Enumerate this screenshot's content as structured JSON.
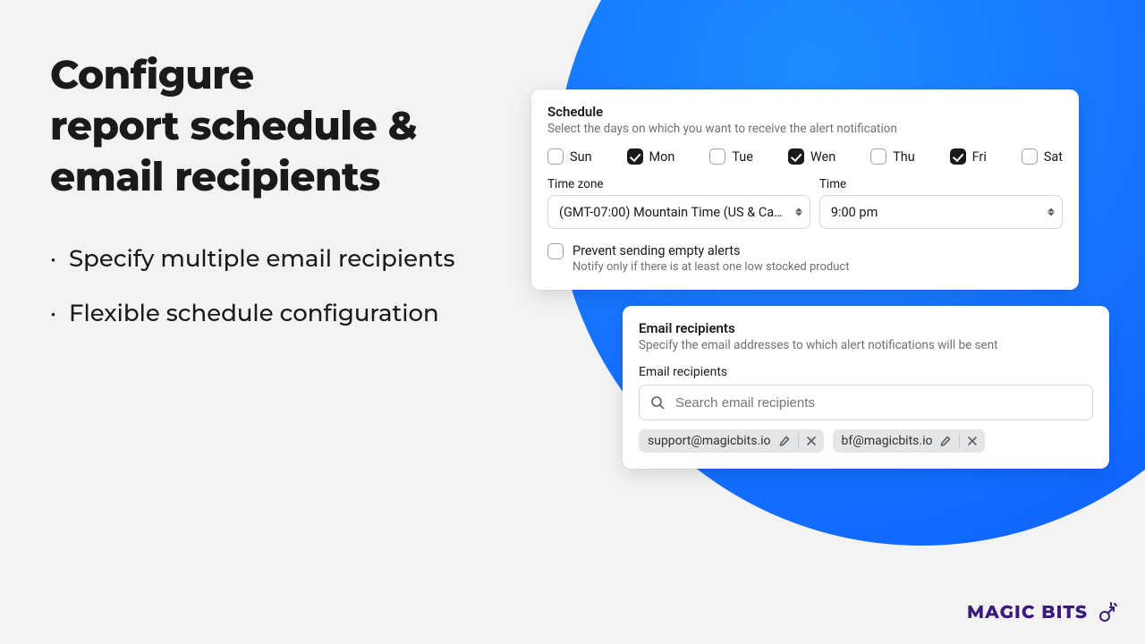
{
  "hero": {
    "headline_l1": "Configure",
    "headline_l2": "report schedule &",
    "headline_l3": "email recipients",
    "bullet1": "Specify multiple email recipients",
    "bullet2": "Flexible schedule configuration"
  },
  "schedule": {
    "title": "Schedule",
    "subtitle": "Select the days on which you want to receive the alert notification",
    "days": [
      {
        "label": "Sun",
        "checked": false
      },
      {
        "label": "Mon",
        "checked": true
      },
      {
        "label": "Tue",
        "checked": false
      },
      {
        "label": "Wen",
        "checked": true
      },
      {
        "label": "Thu",
        "checked": false
      },
      {
        "label": "Fri",
        "checked": true
      },
      {
        "label": "Sat",
        "checked": false
      }
    ],
    "timezone_label": "Time zone",
    "timezone_value": "(GMT-07:00) Mountain Time (US & Ca…",
    "time_label": "Time",
    "time_value": "9:00 pm",
    "prevent_label": "Prevent sending empty alerts",
    "prevent_help": "Notify only if there is at least one low stocked product"
  },
  "recipients": {
    "title": "Email recipients",
    "subtitle": "Specify the email addresses to which alert notifications will be sent",
    "field_label": "Email recipients",
    "search_placeholder": "Search email recipients",
    "chips": [
      "support@magicbits.io",
      "bf@magicbits.io"
    ]
  },
  "brand": {
    "name": "MAGIC BITS"
  }
}
